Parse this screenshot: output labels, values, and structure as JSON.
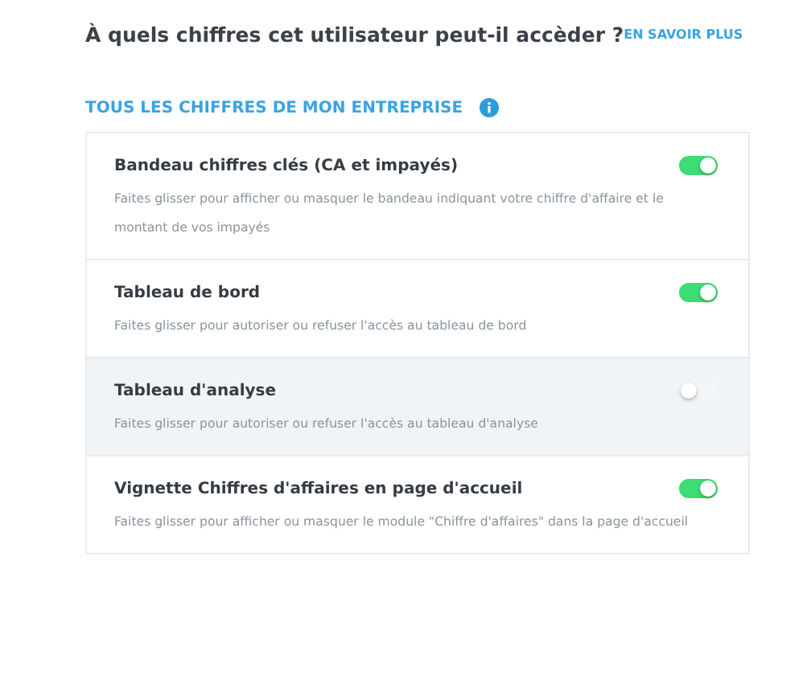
{
  "heading": "À quels chiffres cet utilisateur peut-il accèder ?",
  "learn_more": "EN SAVOIR PLUS",
  "section_title": "TOUS LES CHIFFRES DE MON ENTREPRISE",
  "settings": [
    {
      "title": "Bandeau chiffres clés (CA et impayés)",
      "description": "Faites glisser pour afficher ou masquer le bandeau indiquant votre chiffre d'affaire et le montant de vos impayés",
      "on": true,
      "highlighted": false
    },
    {
      "title": "Tableau de bord",
      "description": "Faites glisser pour autoriser ou refuser l'accès au tableau de bord",
      "on": true,
      "highlighted": false
    },
    {
      "title": "Tableau d'analyse",
      "description": "Faites glisser pour autoriser ou refuser l'accès au tableau d'analyse",
      "on": false,
      "highlighted": true
    },
    {
      "title": "Vignette Chiffres d'affaires en page d'accueil",
      "description": "Faites glisser pour afficher ou masquer le module \"Chiffre d'affaires\" dans la page d'accueil",
      "on": true,
      "highlighted": false
    }
  ]
}
